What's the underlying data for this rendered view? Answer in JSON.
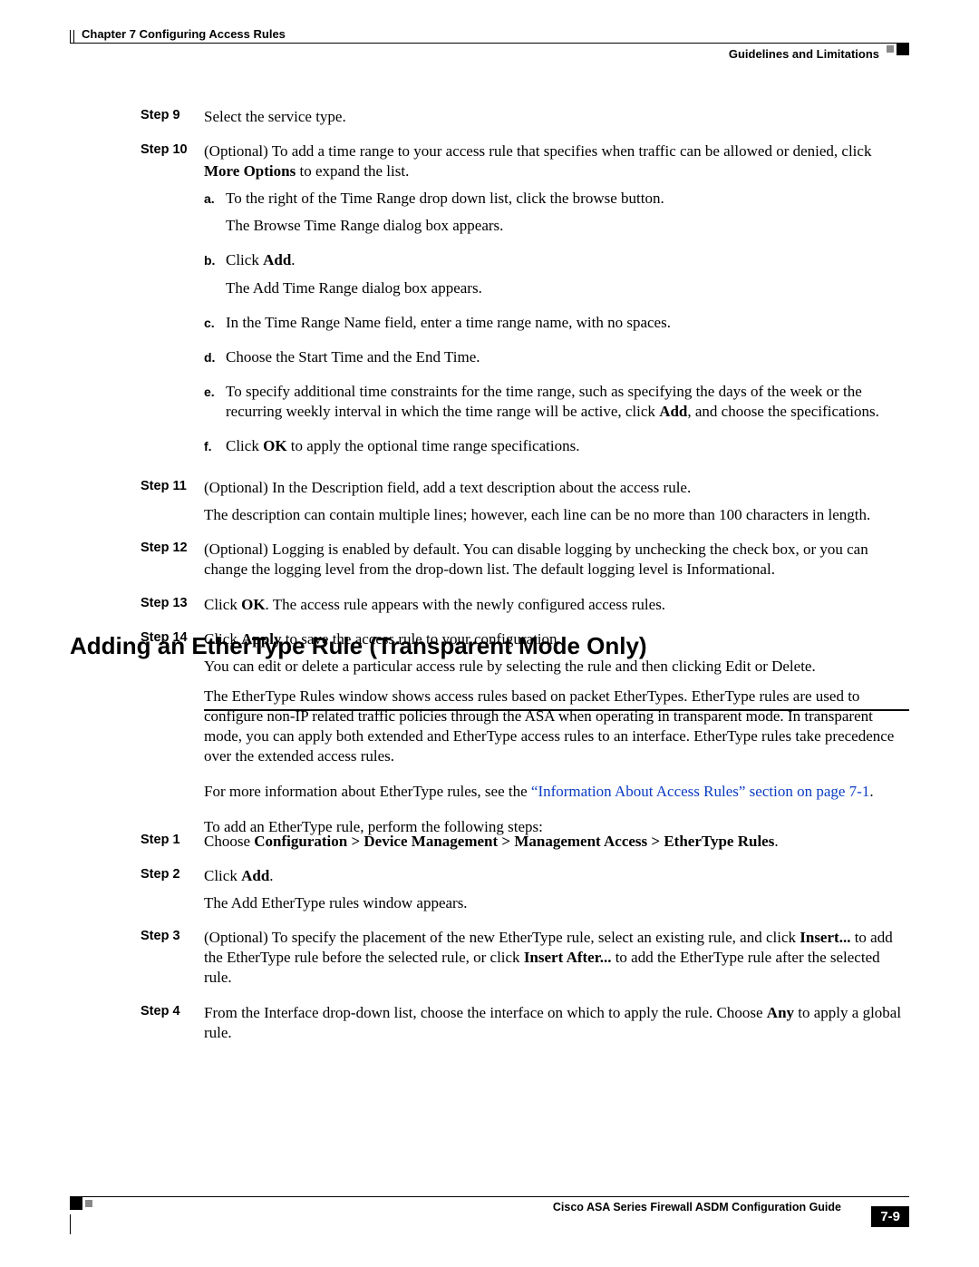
{
  "header": {
    "chapter": "Chapter 7      Configuring Access Rules",
    "section": "Guidelines and Limitations"
  },
  "steps1": {
    "s9": {
      "label": "Step 9",
      "text": "Select the service type."
    },
    "s10": {
      "label": "Step 10",
      "intro_a": "(Optional) To add a time range to your access rule that specifies when traffic can be allowed or denied, click ",
      "intro_b": "More Options",
      "intro_c": " to expand the list.",
      "a": {
        "letter": "a.",
        "p1": "To the right of the Time Range drop down list, click the browse button.",
        "p2": "The Browse Time Range dialog box appears."
      },
      "b": {
        "letter": "b.",
        "p1a": "Click ",
        "p1b": "Add",
        "p1c": ".",
        "p2": "The Add Time Range dialog box appears."
      },
      "c": {
        "letter": "c.",
        "p1": "In the Time Range Name field, enter a time range name, with no spaces."
      },
      "d": {
        "letter": "d.",
        "p1": "Choose the Start Time and the End Time."
      },
      "e": {
        "letter": "e.",
        "p1a": "To specify additional time constraints for the time range, such as specifying the days of the week or the recurring weekly interval in which the time range will be active, click ",
        "p1b": "Add",
        "p1c": ", and choose the specifications."
      },
      "f": {
        "letter": "f.",
        "p1a": "Click ",
        "p1b": "OK",
        "p1c": " to apply the optional time range specifications."
      }
    },
    "s11": {
      "label": "Step 11",
      "p1": "(Optional) In the Description field, add a text description about the access rule.",
      "p2": "The description can contain multiple lines; however, each line can be no more than 100 characters in length."
    },
    "s12": {
      "label": "Step 12",
      "p1": "(Optional) Logging is enabled by default. You can disable logging by unchecking the check box, or you can change the logging level from the drop-down list. The default logging level is Informational."
    },
    "s13": {
      "label": "Step 13",
      "p1a": "Click ",
      "p1b": "OK",
      "p1c": ". The access rule appears with the newly configured access rules."
    },
    "s14": {
      "label": "Step 14",
      "p1a": "Click ",
      "p1b": "Apply",
      "p1c": " to save the access rule to your configuration.",
      "p2": "You can edit or delete a particular access rule by selecting the rule and then clicking Edit or Delete."
    }
  },
  "heading": "Adding an EtherType Rule (Transparent Mode Only)",
  "intro": {
    "p1": "The EtherType Rules window shows access rules based on packet EtherTypes. EtherType rules are used to configure non-IP related traffic policies through the ASA when operating in transparent mode. In transparent mode, you can apply both extended and EtherType access rules to an interface. EtherType rules take precedence over the extended access rules.",
    "p2a": "For more information about EtherType rules, see the ",
    "p2b": "“Information About Access Rules” section on page 7-1",
    "p2c": ".",
    "p3": "To add an EtherType rule, perform the following steps:"
  },
  "steps2": {
    "s1": {
      "label": "Step 1",
      "p1a": "Choose ",
      "p1b": "Configuration > Device Management > Management Access > EtherType Rules",
      "p1c": "."
    },
    "s2": {
      "label": "Step 2",
      "p1a": "Click ",
      "p1b": "Add",
      "p1c": ".",
      "p2": "The Add EtherType rules window appears."
    },
    "s3": {
      "label": "Step 3",
      "p1a": "(Optional) To specify the placement of the new EtherType rule, select an existing rule, and click ",
      "p1b": "Insert...",
      "p1c": " to add the EtherType rule before the selected rule, or click ",
      "p1d": "Insert After...",
      "p1e": " to add the EtherType rule after the selected rule."
    },
    "s4": {
      "label": "Step 4",
      "p1a": "From the Interface drop-down list, choose the interface on which to apply the rule. Choose ",
      "p1b": "Any",
      "p1c": " to apply a global rule."
    }
  },
  "footer": {
    "book": "Cisco ASA Series Firewall ASDM Configuration Guide",
    "pagenum": "7-9"
  }
}
